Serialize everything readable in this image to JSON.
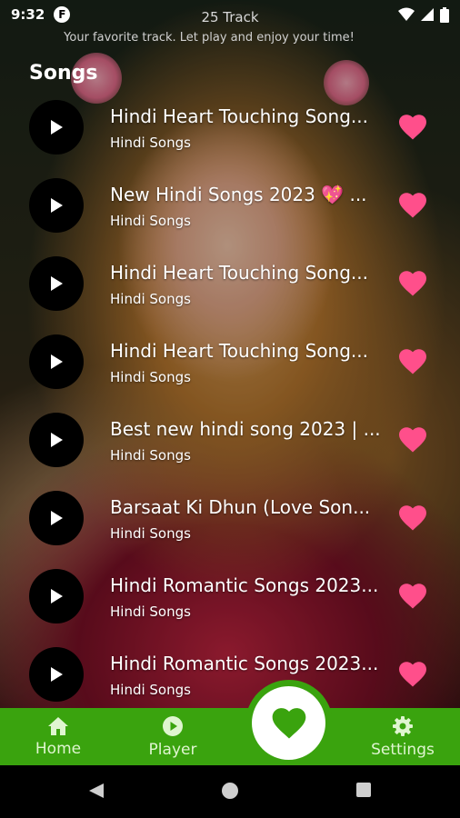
{
  "status_bar": {
    "time": "9:32",
    "app_badge": "F"
  },
  "header": {
    "track_count": "25 Track",
    "subtitle": "Your favorite track. Let play and enjoy your time!"
  },
  "section_title": "Songs",
  "songs": [
    {
      "title": "Hindi Heart Touching Song...",
      "subtitle": "Hindi Songs"
    },
    {
      "title": "New Hindi Songs 2023 💖 ...",
      "subtitle": "Hindi Songs"
    },
    {
      "title": "Hindi Heart Touching Song...",
      "subtitle": "Hindi Songs"
    },
    {
      "title": "Hindi Heart Touching Song...",
      "subtitle": "Hindi Songs"
    },
    {
      "title": "Best new hindi song 2023 | ...",
      "subtitle": "Hindi Songs"
    },
    {
      "title": "Barsaat Ki Dhun (Love Son...",
      "subtitle": "Hindi Songs"
    },
    {
      "title": "Hindi Romantic Songs 2023...",
      "subtitle": "Hindi Songs"
    },
    {
      "title": "Hindi Romantic Songs 2023...",
      "subtitle": "Hindi Songs"
    }
  ],
  "bottom_nav": {
    "home": "Home",
    "player": "Player",
    "settings": "Settings"
  },
  "colors": {
    "nav_green": "#3aa30e",
    "heart_pink": "#ff4f8b"
  },
  "icons": {
    "play": "play-icon",
    "favorite": "heart-icon",
    "home": "home-icon",
    "player": "play-circle-icon",
    "settings": "gear-icon"
  }
}
